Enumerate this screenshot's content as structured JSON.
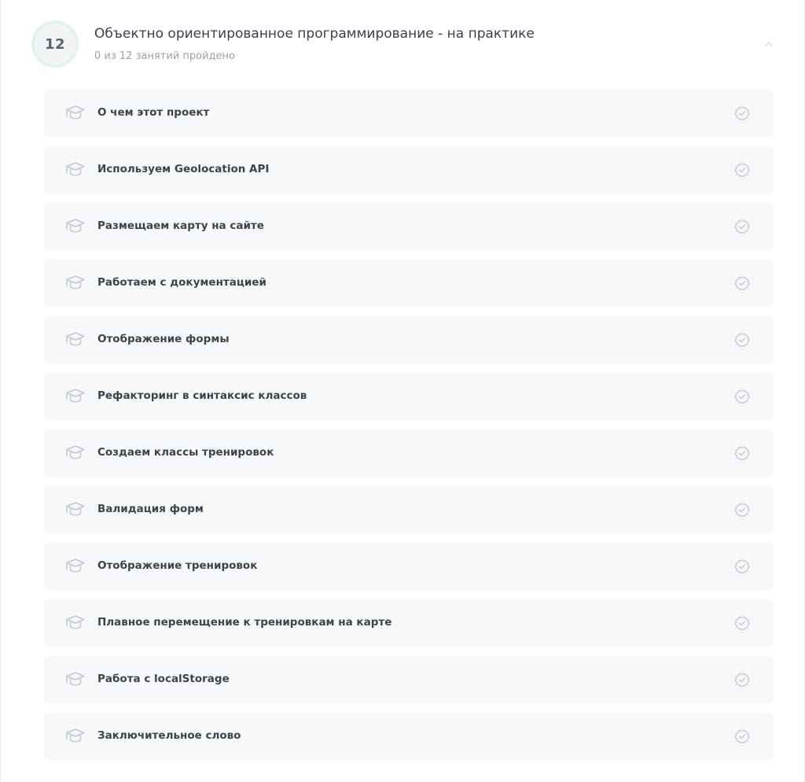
{
  "module": {
    "lesson_count": "12",
    "title": "Объектно ориентированное программирование - на практике",
    "progress_text": "0 из 12 занятий пройдено",
    "toggle_icon": "chevron-up-icon",
    "expanded": true
  },
  "lessons": [
    {
      "title": "О чем этот проект",
      "icon": "graduation-cap-icon",
      "status_icon": "badge-check-icon",
      "completed": false
    },
    {
      "title": "Используем Geolocation API",
      "icon": "graduation-cap-icon",
      "status_icon": "badge-check-icon",
      "completed": false
    },
    {
      "title": "Размещаем карту на сайте",
      "icon": "graduation-cap-icon",
      "status_icon": "badge-check-icon",
      "completed": false
    },
    {
      "title": "Работаем с документацией",
      "icon": "graduation-cap-icon",
      "status_icon": "badge-check-icon",
      "completed": false
    },
    {
      "title": "Отображение формы",
      "icon": "graduation-cap-icon",
      "status_icon": "badge-check-icon",
      "completed": false
    },
    {
      "title": "Рефакторинг в синтаксис классов",
      "icon": "graduation-cap-icon",
      "status_icon": "badge-check-icon",
      "completed": false
    },
    {
      "title": "Создаем классы тренировок",
      "icon": "graduation-cap-icon",
      "status_icon": "badge-check-icon",
      "completed": false
    },
    {
      "title": "Валидация форм",
      "icon": "graduation-cap-icon",
      "status_icon": "badge-check-icon",
      "completed": false
    },
    {
      "title": "Отображение тренировок",
      "icon": "graduation-cap-icon",
      "status_icon": "badge-check-icon",
      "completed": false
    },
    {
      "title": "Плавное перемещение к тренировкам на карте",
      "icon": "graduation-cap-icon",
      "status_icon": "badge-check-icon",
      "completed": false
    },
    {
      "title": "Работа с localStorage",
      "icon": "graduation-cap-icon",
      "status_icon": "badge-check-icon",
      "completed": false
    },
    {
      "title": "Заключительное слово",
      "icon": "graduation-cap-icon",
      "status_icon": "badge-check-icon",
      "completed": false
    }
  ],
  "colors": {
    "badge_ring": "#e2f3ef",
    "badge_fill": "#f3f4f6",
    "lesson_background": "#f7f8fa",
    "icon_muted": "#c4c8cf",
    "title_text": "#3a404b",
    "muted_text": "#9ba1ab"
  }
}
